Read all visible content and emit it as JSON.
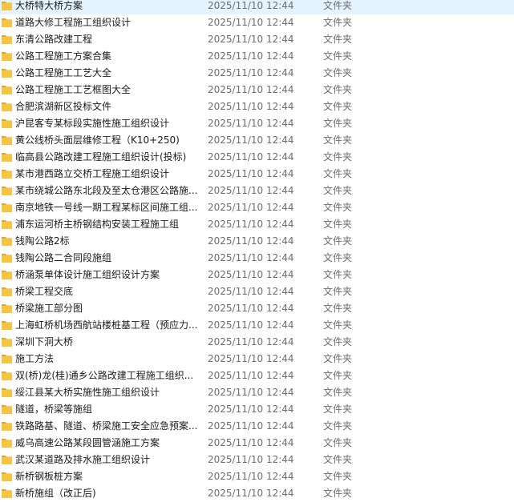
{
  "folder_icon": "folder-icon",
  "folder_color": "#f5c542",
  "files": [
    {
      "name": "大桥特大桥方案",
      "date": "2025/11/10 12:44",
      "type": "文件夹"
    },
    {
      "name": "道路大修工程施工组织设计",
      "date": "2025/11/10 12:44",
      "type": "文件夹"
    },
    {
      "name": "东清公路改建工程",
      "date": "2025/11/10 12:44",
      "type": "文件夹"
    },
    {
      "name": "公路工程施工方案合集",
      "date": "2025/11/10 12:44",
      "type": "文件夹"
    },
    {
      "name": "公路工程施工工艺大全",
      "date": "2025/11/10 12:44",
      "type": "文件夹"
    },
    {
      "name": "公路工程施工工艺框图大全",
      "date": "2025/11/10 12:44",
      "type": "文件夹"
    },
    {
      "name": "合肥滨湖新区投标文件",
      "date": "2025/11/10 12:44",
      "type": "文件夹"
    },
    {
      "name": "沪昆客专某标段实施性施工组织设计",
      "date": "2025/11/10 12:44",
      "type": "文件夹"
    },
    {
      "name": "黄公线桥头面层维修工程（K10+250)",
      "date": "2025/11/10 12:44",
      "type": "文件夹"
    },
    {
      "name": "临高县公路改建工程施工组织设计(投标)",
      "date": "2025/11/10 12:44",
      "type": "文件夹"
    },
    {
      "name": "某市港西路立交桥工程施工组织设计",
      "date": "2025/11/10 12:44",
      "type": "文件夹"
    },
    {
      "name": "某市绕城公路东北段及至太仓港区公路施...",
      "date": "2025/11/10 12:44",
      "type": "文件夹"
    },
    {
      "name": "南京地铁一号线一期工程某标区间施工组...",
      "date": "2025/11/10 12:44",
      "type": "文件夹"
    },
    {
      "name": "浦东运河桥主桥钢结构安装工程施工组",
      "date": "2025/11/10 12:44",
      "type": "文件夹"
    },
    {
      "name": "钱陶公路2标",
      "date": "2025/11/10 12:44",
      "type": "文件夹"
    },
    {
      "name": "钱陶公路二合同段施组",
      "date": "2025/11/10 12:44",
      "type": "文件夹"
    },
    {
      "name": "桥涵泵单体设计施工组织设计方案",
      "date": "2025/11/10 12:44",
      "type": "文件夹"
    },
    {
      "name": "桥梁工程交底",
      "date": "2025/11/10 12:44",
      "type": "文件夹"
    },
    {
      "name": "桥梁施工部分图",
      "date": "2025/11/10 12:44",
      "type": "文件夹"
    },
    {
      "name": "上海虹桥机场西航站楼桩基工程（预应力...",
      "date": "2025/11/10 12:44",
      "type": "文件夹"
    },
    {
      "name": "深圳下洞大桥",
      "date": "2025/11/10 12:44",
      "type": "文件夹"
    },
    {
      "name": "施工方法",
      "date": "2025/11/10 12:44",
      "type": "文件夹"
    },
    {
      "name": "双(桥)龙(桂)通乡公路改建工程施工组织...",
      "date": "2025/11/10 12:44",
      "type": "文件夹"
    },
    {
      "name": "绥江县某大桥实施性施工组织设计",
      "date": "2025/11/10 12:44",
      "type": "文件夹"
    },
    {
      "name": "隧道，桥梁等施组",
      "date": "2025/11/10 12:44",
      "type": "文件夹"
    },
    {
      "name": "铁路路基、隧道、桥梁施工安全应急预案...",
      "date": "2025/11/10 12:44",
      "type": "文件夹"
    },
    {
      "name": "威乌高速公路某段圆管涵施工方案",
      "date": "2025/11/10 12:44",
      "type": "文件夹"
    },
    {
      "name": "武汉某道路及排水施工组织设计",
      "date": "2025/11/10 12:44",
      "type": "文件夹"
    },
    {
      "name": "新桥钢板桩方案",
      "date": "2025/11/10 12:44",
      "type": "文件夹"
    },
    {
      "name": "新桥施组（改正后)",
      "date": "2025/11/10 12:44",
      "type": "文件夹"
    }
  ]
}
